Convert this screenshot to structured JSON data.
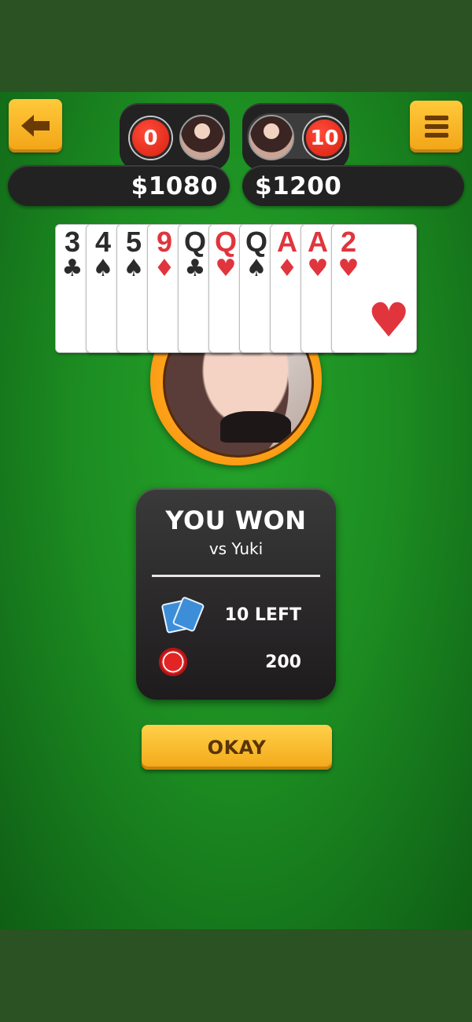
{
  "players": {
    "me": {
      "score": "0",
      "money": "$1080"
    },
    "opponent": {
      "score": "10",
      "money": "$1200"
    }
  },
  "cards": [
    {
      "rank": "3",
      "suit": "♣",
      "color": "#2b2b2b"
    },
    {
      "rank": "4",
      "suit": "♠",
      "color": "#2b2b2b"
    },
    {
      "rank": "5",
      "suit": "♠",
      "color": "#2b2b2b"
    },
    {
      "rank": "9",
      "suit": "♦",
      "color": "#e0353d"
    },
    {
      "rank": "Q",
      "suit": "♣",
      "color": "#2b2b2b"
    },
    {
      "rank": "Q",
      "suit": "♥",
      "color": "#e0353d"
    },
    {
      "rank": "Q",
      "suit": "♠",
      "color": "#2b2b2b"
    },
    {
      "rank": "A",
      "suit": "♦",
      "color": "#e0353d"
    },
    {
      "rank": "A",
      "suit": "♥",
      "color": "#e0353d"
    },
    {
      "rank": "2",
      "suit": "♥",
      "color": "#e0353d"
    }
  ],
  "result": {
    "title": "YOU WON",
    "subtitle": "vs Yuki",
    "cards_left": "10 LEFT",
    "chips": "200"
  },
  "okay_label": "OKAY",
  "icons": {
    "back": "arrow-left-icon",
    "menu": "hamburger-menu-icon",
    "cards": "cards-icon",
    "chip": "poker-chip-icon"
  },
  "colors": {
    "table_green": "#1d8e22",
    "button_yellow": "#ffc93a",
    "badge_red": "#d8210f",
    "ring_orange": "#ffa21c"
  }
}
